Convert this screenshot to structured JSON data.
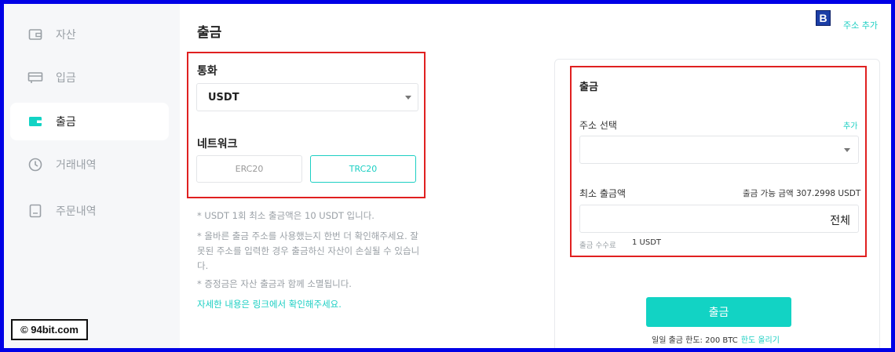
{
  "sidebar": {
    "items": [
      {
        "label": "자산",
        "icon": "wallet-icon",
        "active": false
      },
      {
        "label": "입금",
        "icon": "deposit-icon",
        "active": false
      },
      {
        "label": "출금",
        "icon": "withdraw-icon",
        "active": true
      },
      {
        "label": "거래내역",
        "icon": "clock-icon",
        "active": false
      },
      {
        "label": "주문내역",
        "icon": "document-icon",
        "active": false
      }
    ]
  },
  "watermark": "© 94bit.com",
  "page_title": "출금",
  "currency": {
    "label": "통화",
    "value": "USDT"
  },
  "network": {
    "label": "네트워크",
    "options": [
      "ERC20",
      "TRC20"
    ],
    "selected": "TRC20"
  },
  "notes": [
    "* USDT 1회 최소 출금액은 10 USDT 입니다.",
    "* 올바른 출금 주소를 사용했는지 한번 더 확인해주세요. 잘못된 주소를 입력한 경우 출금하신 자산이 손실될 수 있습니다.",
    "* 증정금은 자산 출금과 함께 소멸됩니다."
  ],
  "link_text": "자세한 내용은 링크에서 확인해주세요.",
  "header": {
    "logo": "B",
    "add_address": "주소 추가"
  },
  "card": {
    "title": "출금",
    "address_label": "주소 선택",
    "add_label": "추가",
    "amount_label": "최소 출금액",
    "available": "출금 가능 금액 307.2998 USDT",
    "all_label": "전체",
    "fee_label": "출금 수수료",
    "fee_value": "1 USDT",
    "button": "출금",
    "limit_label": "일일 출금 한도: 200 BTC",
    "limit_link": "한도 올리기"
  },
  "colors": {
    "accent": "#12d3c4",
    "highlight": "#e02020",
    "frame": "#0000e6"
  }
}
